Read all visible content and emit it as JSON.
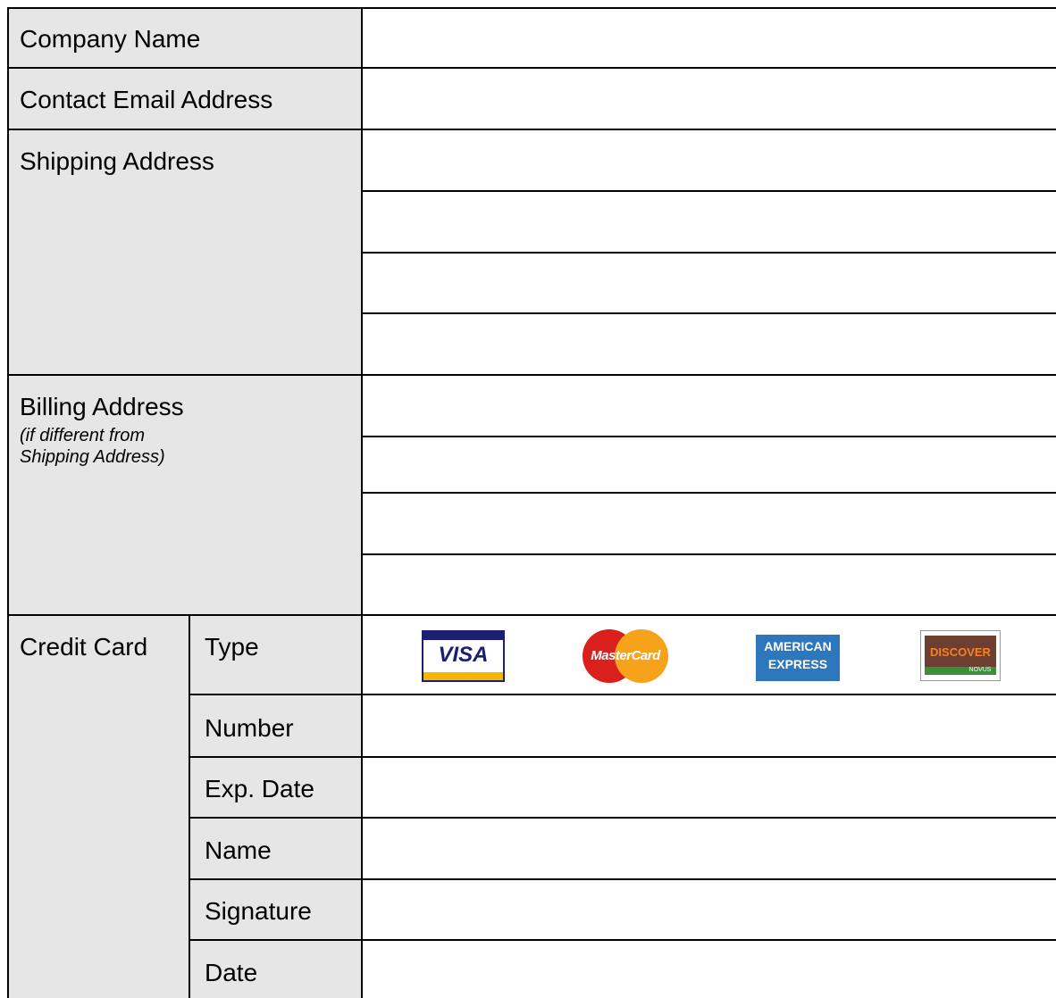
{
  "form": {
    "company_name": {
      "label": "Company Name",
      "value": ""
    },
    "contact_email": {
      "label": "Contact Email Address",
      "value": ""
    },
    "shipping_address": {
      "label": "Shipping Address",
      "lines": [
        "",
        "",
        "",
        ""
      ]
    },
    "billing_address": {
      "label": "Billing Address",
      "note_line1": "(if different from",
      "note_line2": "Shipping Address)",
      "lines": [
        "",
        "",
        "",
        ""
      ]
    },
    "credit_card": {
      "label": "Credit Card",
      "type_label": "Type",
      "number_label": "Number",
      "exp_date_label": "Exp. Date",
      "name_label": "Name",
      "signature_label": "Signature",
      "date_label": "Date",
      "card_types": [
        {
          "name": "visa",
          "text": "VISA",
          "color": "#1a1f71"
        },
        {
          "name": "mastercard",
          "text": "MasterCard",
          "color": "#eb001b"
        },
        {
          "name": "american-express",
          "text_line1": "AMERICAN",
          "text_line2": "EXPRESS",
          "color": "#2e77bc"
        },
        {
          "name": "discover",
          "text": "DISCOVER",
          "subtext": "NOVUS",
          "color": "#f58220"
        }
      ]
    }
  }
}
